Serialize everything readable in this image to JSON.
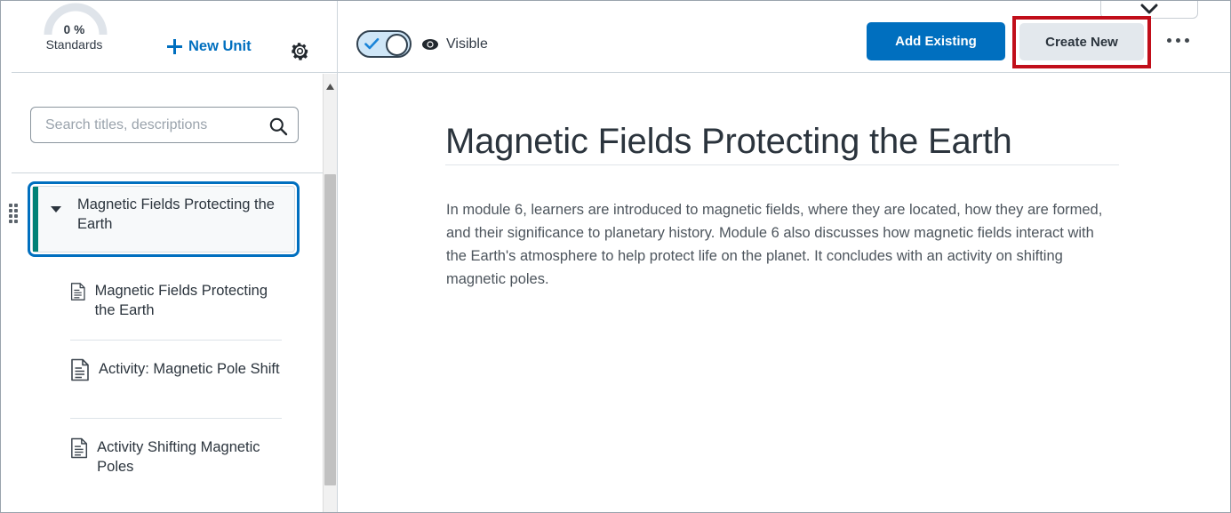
{
  "header": {
    "gauge": {
      "percent": "0 %",
      "label": "Standards",
      "track_color": "#dfe4ea"
    },
    "new_unit_label": "New Unit",
    "settings_icon": "gear-icon",
    "visibility": {
      "toggle_state": "on",
      "label": "Visible",
      "icon": "eye-icon"
    },
    "buttons": {
      "add_existing": "Add Existing",
      "create_new": "Create New",
      "more_label": "..."
    },
    "highlight_color": "#c10e1a",
    "primary_color": "#006fbf",
    "secondary_color": "#e3e8ed"
  },
  "sidebar": {
    "search": {
      "placeholder": "Search titles, descriptions",
      "value": "",
      "icon": "search-icon"
    },
    "unit": {
      "title": "Magnetic Fields Protecting the Earth",
      "expanded": true,
      "accent_color": "#008177",
      "focus_color": "#006fbf",
      "caret_icon": "caret-down-icon",
      "drag_icon": "drag-handle-icon"
    },
    "children": [
      {
        "label": "Magnetic Fields Protecting the Earth",
        "icon": "document-icon"
      },
      {
        "label": "Activity: Magnetic Pole Shift",
        "icon": "document-icon"
      },
      {
        "label": "Activity Shifting Magnetic Poles",
        "icon": "document-icon"
      }
    ],
    "scrollbar": {
      "up_arrow_icon": "scroll-up-arrow-icon",
      "thumb_color": "#c1c1c1"
    }
  },
  "main": {
    "title": "Magnetic Fields Protecting the Earth",
    "description": "In module 6, learners are introduced to magnetic fields, where they are located, how they are formed, and their significance to planetary history. Module 6 also discusses how magnetic fields interact with the Earth's atmosphere to help protect life on the planet. It concludes with an activity on shifting magnetic poles."
  }
}
